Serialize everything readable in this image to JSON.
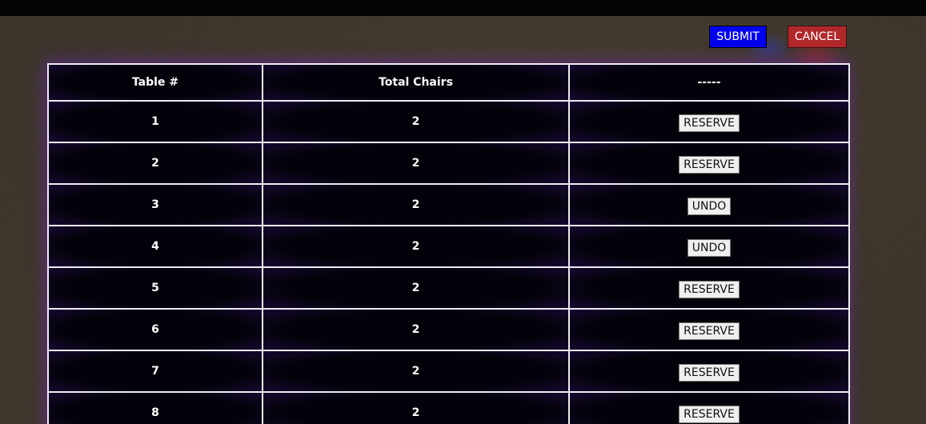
{
  "toolbar": {
    "submit_label": "SUBMIT",
    "cancel_label": "CANCEL"
  },
  "colors": {
    "submit_bg": "#0000ee",
    "cancel_bg": "#b1282a",
    "table_bg": "#03020a",
    "glow": "#7828c8"
  },
  "table": {
    "headers": [
      "Table #",
      "Total Chairs",
      "-----"
    ],
    "rows": [
      {
        "table": "1",
        "chairs": "2",
        "action": "RESERVE"
      },
      {
        "table": "2",
        "chairs": "2",
        "action": "RESERVE"
      },
      {
        "table": "3",
        "chairs": "2",
        "action": "UNDO"
      },
      {
        "table": "4",
        "chairs": "2",
        "action": "UNDO"
      },
      {
        "table": "5",
        "chairs": "2",
        "action": "RESERVE"
      },
      {
        "table": "6",
        "chairs": "2",
        "action": "RESERVE"
      },
      {
        "table": "7",
        "chairs": "2",
        "action": "RESERVE"
      },
      {
        "table": "8",
        "chairs": "2",
        "action": "RESERVE"
      }
    ]
  }
}
